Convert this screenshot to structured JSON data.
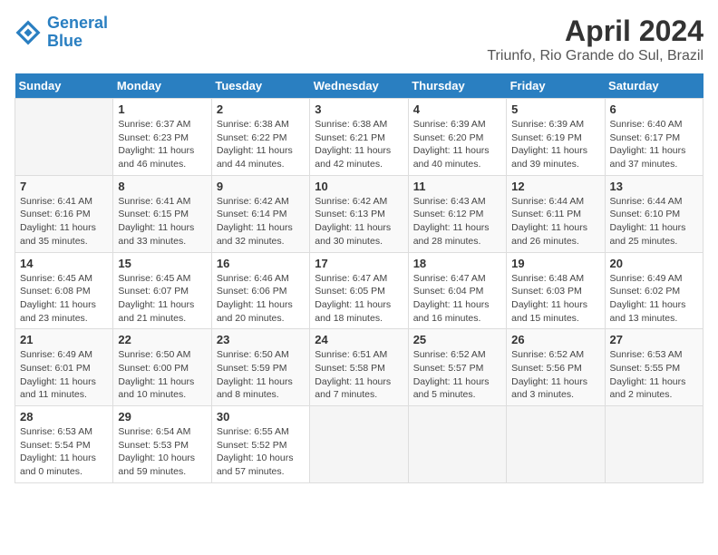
{
  "logo": {
    "line1": "General",
    "line2": "Blue"
  },
  "title": "April 2024",
  "subtitle": "Triunfo, Rio Grande do Sul, Brazil",
  "days_header": [
    "Sunday",
    "Monday",
    "Tuesday",
    "Wednesday",
    "Thursday",
    "Friday",
    "Saturday"
  ],
  "weeks": [
    [
      {
        "day": "",
        "info": ""
      },
      {
        "day": "1",
        "info": "Sunrise: 6:37 AM\nSunset: 6:23 PM\nDaylight: 11 hours\nand 46 minutes."
      },
      {
        "day": "2",
        "info": "Sunrise: 6:38 AM\nSunset: 6:22 PM\nDaylight: 11 hours\nand 44 minutes."
      },
      {
        "day": "3",
        "info": "Sunrise: 6:38 AM\nSunset: 6:21 PM\nDaylight: 11 hours\nand 42 minutes."
      },
      {
        "day": "4",
        "info": "Sunrise: 6:39 AM\nSunset: 6:20 PM\nDaylight: 11 hours\nand 40 minutes."
      },
      {
        "day": "5",
        "info": "Sunrise: 6:39 AM\nSunset: 6:19 PM\nDaylight: 11 hours\nand 39 minutes."
      },
      {
        "day": "6",
        "info": "Sunrise: 6:40 AM\nSunset: 6:17 PM\nDaylight: 11 hours\nand 37 minutes."
      }
    ],
    [
      {
        "day": "7",
        "info": "Sunrise: 6:41 AM\nSunset: 6:16 PM\nDaylight: 11 hours\nand 35 minutes."
      },
      {
        "day": "8",
        "info": "Sunrise: 6:41 AM\nSunset: 6:15 PM\nDaylight: 11 hours\nand 33 minutes."
      },
      {
        "day": "9",
        "info": "Sunrise: 6:42 AM\nSunset: 6:14 PM\nDaylight: 11 hours\nand 32 minutes."
      },
      {
        "day": "10",
        "info": "Sunrise: 6:42 AM\nSunset: 6:13 PM\nDaylight: 11 hours\nand 30 minutes."
      },
      {
        "day": "11",
        "info": "Sunrise: 6:43 AM\nSunset: 6:12 PM\nDaylight: 11 hours\nand 28 minutes."
      },
      {
        "day": "12",
        "info": "Sunrise: 6:44 AM\nSunset: 6:11 PM\nDaylight: 11 hours\nand 26 minutes."
      },
      {
        "day": "13",
        "info": "Sunrise: 6:44 AM\nSunset: 6:10 PM\nDaylight: 11 hours\nand 25 minutes."
      }
    ],
    [
      {
        "day": "14",
        "info": "Sunrise: 6:45 AM\nSunset: 6:08 PM\nDaylight: 11 hours\nand 23 minutes."
      },
      {
        "day": "15",
        "info": "Sunrise: 6:45 AM\nSunset: 6:07 PM\nDaylight: 11 hours\nand 21 minutes."
      },
      {
        "day": "16",
        "info": "Sunrise: 6:46 AM\nSunset: 6:06 PM\nDaylight: 11 hours\nand 20 minutes."
      },
      {
        "day": "17",
        "info": "Sunrise: 6:47 AM\nSunset: 6:05 PM\nDaylight: 11 hours\nand 18 minutes."
      },
      {
        "day": "18",
        "info": "Sunrise: 6:47 AM\nSunset: 6:04 PM\nDaylight: 11 hours\nand 16 minutes."
      },
      {
        "day": "19",
        "info": "Sunrise: 6:48 AM\nSunset: 6:03 PM\nDaylight: 11 hours\nand 15 minutes."
      },
      {
        "day": "20",
        "info": "Sunrise: 6:49 AM\nSunset: 6:02 PM\nDaylight: 11 hours\nand 13 minutes."
      }
    ],
    [
      {
        "day": "21",
        "info": "Sunrise: 6:49 AM\nSunset: 6:01 PM\nDaylight: 11 hours\nand 11 minutes."
      },
      {
        "day": "22",
        "info": "Sunrise: 6:50 AM\nSunset: 6:00 PM\nDaylight: 11 hours\nand 10 minutes."
      },
      {
        "day": "23",
        "info": "Sunrise: 6:50 AM\nSunset: 5:59 PM\nDaylight: 11 hours\nand 8 minutes."
      },
      {
        "day": "24",
        "info": "Sunrise: 6:51 AM\nSunset: 5:58 PM\nDaylight: 11 hours\nand 7 minutes."
      },
      {
        "day": "25",
        "info": "Sunrise: 6:52 AM\nSunset: 5:57 PM\nDaylight: 11 hours\nand 5 minutes."
      },
      {
        "day": "26",
        "info": "Sunrise: 6:52 AM\nSunset: 5:56 PM\nDaylight: 11 hours\nand 3 minutes."
      },
      {
        "day": "27",
        "info": "Sunrise: 6:53 AM\nSunset: 5:55 PM\nDaylight: 11 hours\nand 2 minutes."
      }
    ],
    [
      {
        "day": "28",
        "info": "Sunrise: 6:53 AM\nSunset: 5:54 PM\nDaylight: 11 hours\nand 0 minutes."
      },
      {
        "day": "29",
        "info": "Sunrise: 6:54 AM\nSunset: 5:53 PM\nDaylight: 10 hours\nand 59 minutes."
      },
      {
        "day": "30",
        "info": "Sunrise: 6:55 AM\nSunset: 5:52 PM\nDaylight: 10 hours\nand 57 minutes."
      },
      {
        "day": "",
        "info": ""
      },
      {
        "day": "",
        "info": ""
      },
      {
        "day": "",
        "info": ""
      },
      {
        "day": "",
        "info": ""
      }
    ]
  ]
}
